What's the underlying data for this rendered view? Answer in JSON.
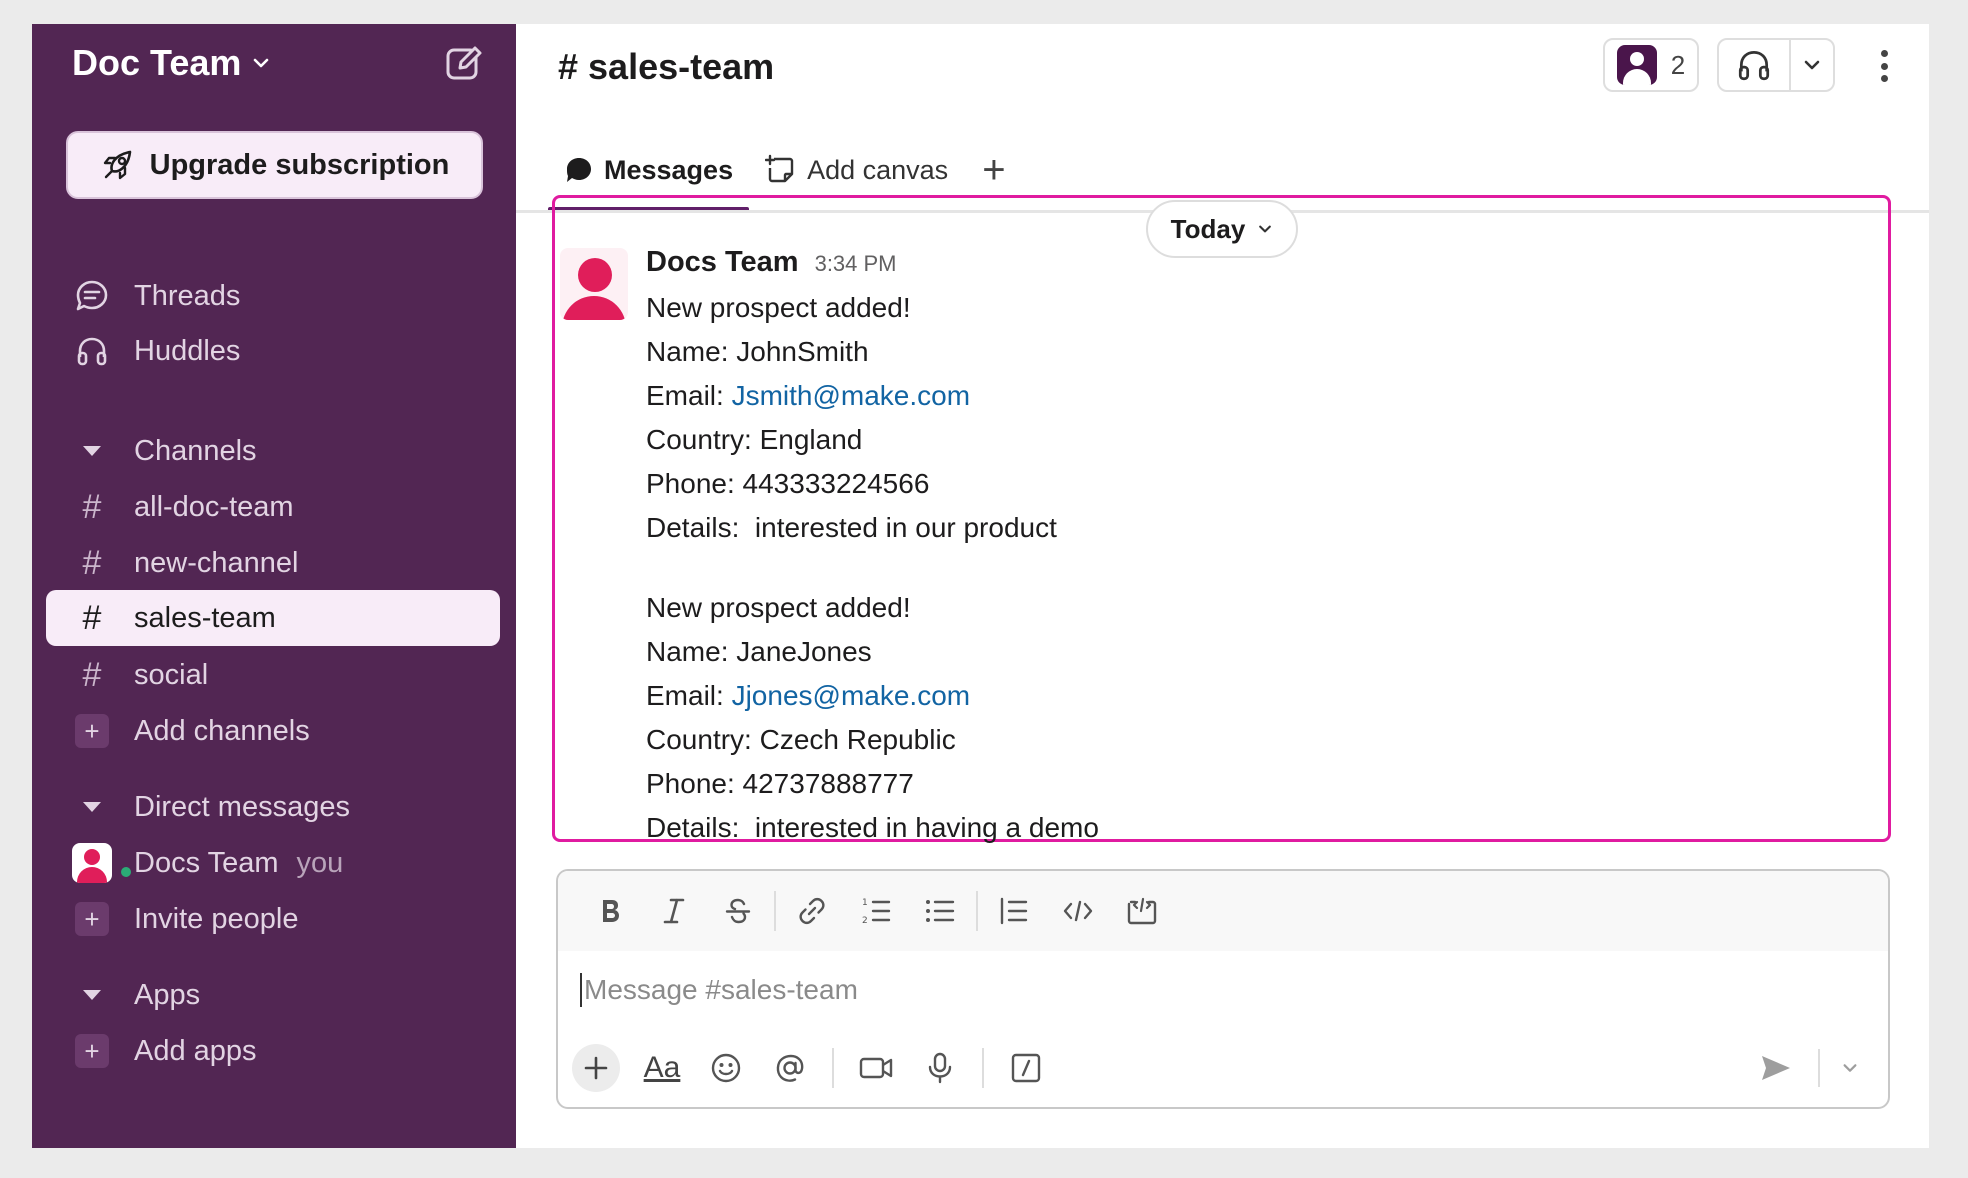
{
  "workspace": {
    "name": "Doc Team",
    "upgrade_label": "Upgrade subscription"
  },
  "sidebar": {
    "threads": "Threads",
    "huddles": "Huddles",
    "channels_header": "Channels",
    "channels": [
      {
        "name": "all-doc-team",
        "active": false
      },
      {
        "name": "new-channel",
        "active": false
      },
      {
        "name": "sales-team",
        "active": true
      },
      {
        "name": "social",
        "active": false
      }
    ],
    "add_channels": "Add channels",
    "dm_header": "Direct messages",
    "dm_user": "Docs Team",
    "dm_you": "you",
    "invite_people": "Invite people",
    "apps_header": "Apps",
    "add_apps": "Add apps",
    "hash_symbol": "#",
    "plus_symbol": "+"
  },
  "channel": {
    "hash": "#",
    "name": "sales-team",
    "member_count": "2"
  },
  "tabs": {
    "messages": "Messages",
    "add_canvas": "Add canvas",
    "plus": "+"
  },
  "day_divider": "Today",
  "message": {
    "sender": "Docs Team",
    "time": "3:34 PM",
    "block1": {
      "title": "New prospect added!",
      "name": "Name: JohnSmith",
      "email_prefix": "Email: ",
      "email": "Jsmith@make.com",
      "country": "Country: England",
      "phone": "Phone: 443333224566",
      "details": "Details:  interested in our product"
    },
    "block2": {
      "title": "New prospect added!",
      "name": "Name: JaneJones",
      "email_prefix": "Email: ",
      "email": "Jjones@make.com",
      "country": "Country: Czech Republic",
      "phone": "Phone: 42737888777",
      "details": "Details:  interested in having a demo"
    }
  },
  "composer": {
    "placeholder": "Message #sales-team",
    "aa_label": "Aa"
  },
  "colors": {
    "sidebar_bg": "#522653",
    "highlight_border": "#e01ba0",
    "link": "#1264a3",
    "avatar": "#e01e5a",
    "presence": "#2bac76"
  }
}
